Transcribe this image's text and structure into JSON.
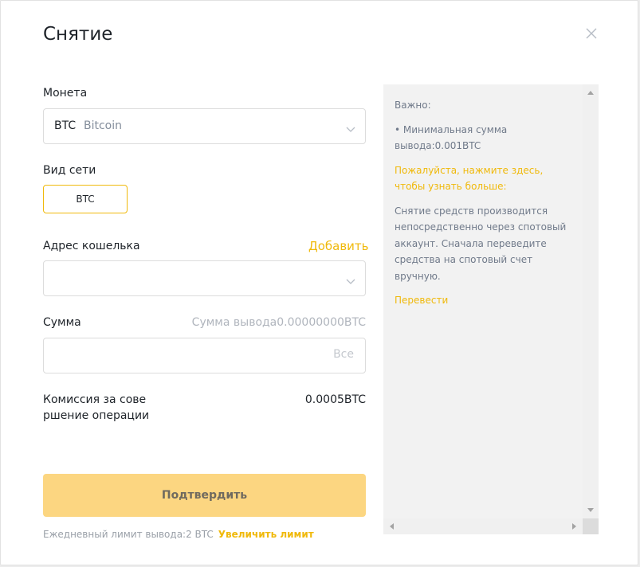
{
  "modal": {
    "title": "Снятие"
  },
  "coin": {
    "label": "Монета",
    "code": "BTC",
    "name": "Bitcoin"
  },
  "network": {
    "label": "Вид сети",
    "selected": "BTC"
  },
  "address": {
    "label": "Адрес кошелька",
    "add_link": "Добавить",
    "value": ""
  },
  "amount": {
    "label": "Сумма",
    "hint": "Сумма вывода0.00000000BTC",
    "value": "",
    "all_button": "Все"
  },
  "fee": {
    "label_line1": "Комиссия за сове",
    "label_line2": "ршение операции",
    "value": "0.0005BTC"
  },
  "confirm": {
    "label": "Подтвердить"
  },
  "limit": {
    "text": "Ежедневный лимит вывода:2 BTC",
    "link": "Увеличить лимит"
  },
  "panel": {
    "important": "Важно:",
    "min_line1": "• Минимальная сумма",
    "min_line2": "вывода:0.001BTC",
    "more_line1": "Пожалуйста, нажмите здесь,",
    "more_line2": "чтобы узнать больше:",
    "info_line1": "Снятие средств производится",
    "info_line2": "непосредственно через спотовый",
    "info_line3": "аккаунт. Сначала переведите",
    "info_line4": "средства на спотовый счет",
    "info_line5": "вручную.",
    "transfer_link": "Перевести"
  },
  "colors": {
    "accent": "#f0b90b",
    "confirm_bg": "#fcd681",
    "panel_bg": "#f2f2f2"
  }
}
